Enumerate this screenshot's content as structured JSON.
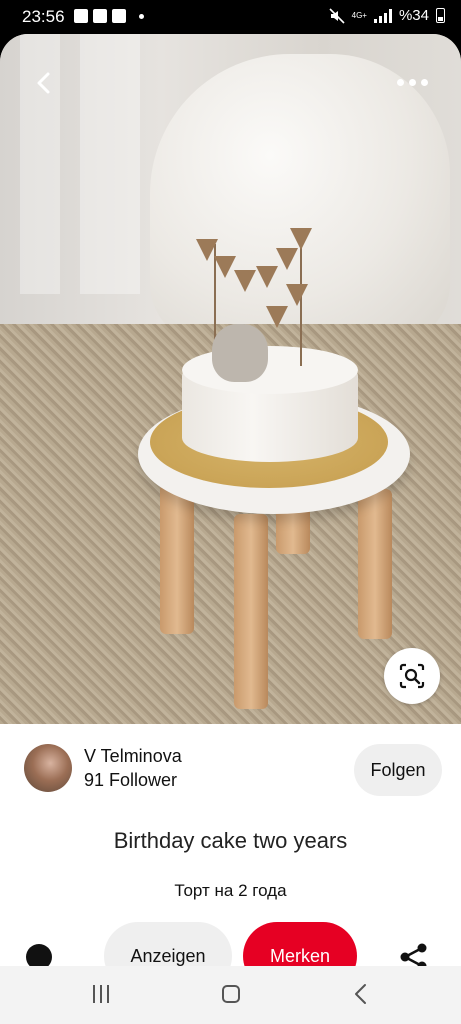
{
  "status_bar": {
    "time": "23:56",
    "network": "4G+",
    "battery": "%34"
  },
  "pin": {
    "title": "Birthday cake two years",
    "description": "Торт на 2 года"
  },
  "author": {
    "name": "V Telminova",
    "followers": "91 Follower"
  },
  "actions": {
    "follow_label": "Folgen",
    "show_label": "Anzeigen",
    "save_label": "Merken"
  },
  "colors": {
    "accent": "#e60023",
    "secondary_button": "#efefef"
  },
  "icons": [
    "back-icon",
    "more-icon",
    "visual-search-icon",
    "share-icon",
    "recent-apps-icon",
    "home-icon",
    "nav-back-icon"
  ]
}
